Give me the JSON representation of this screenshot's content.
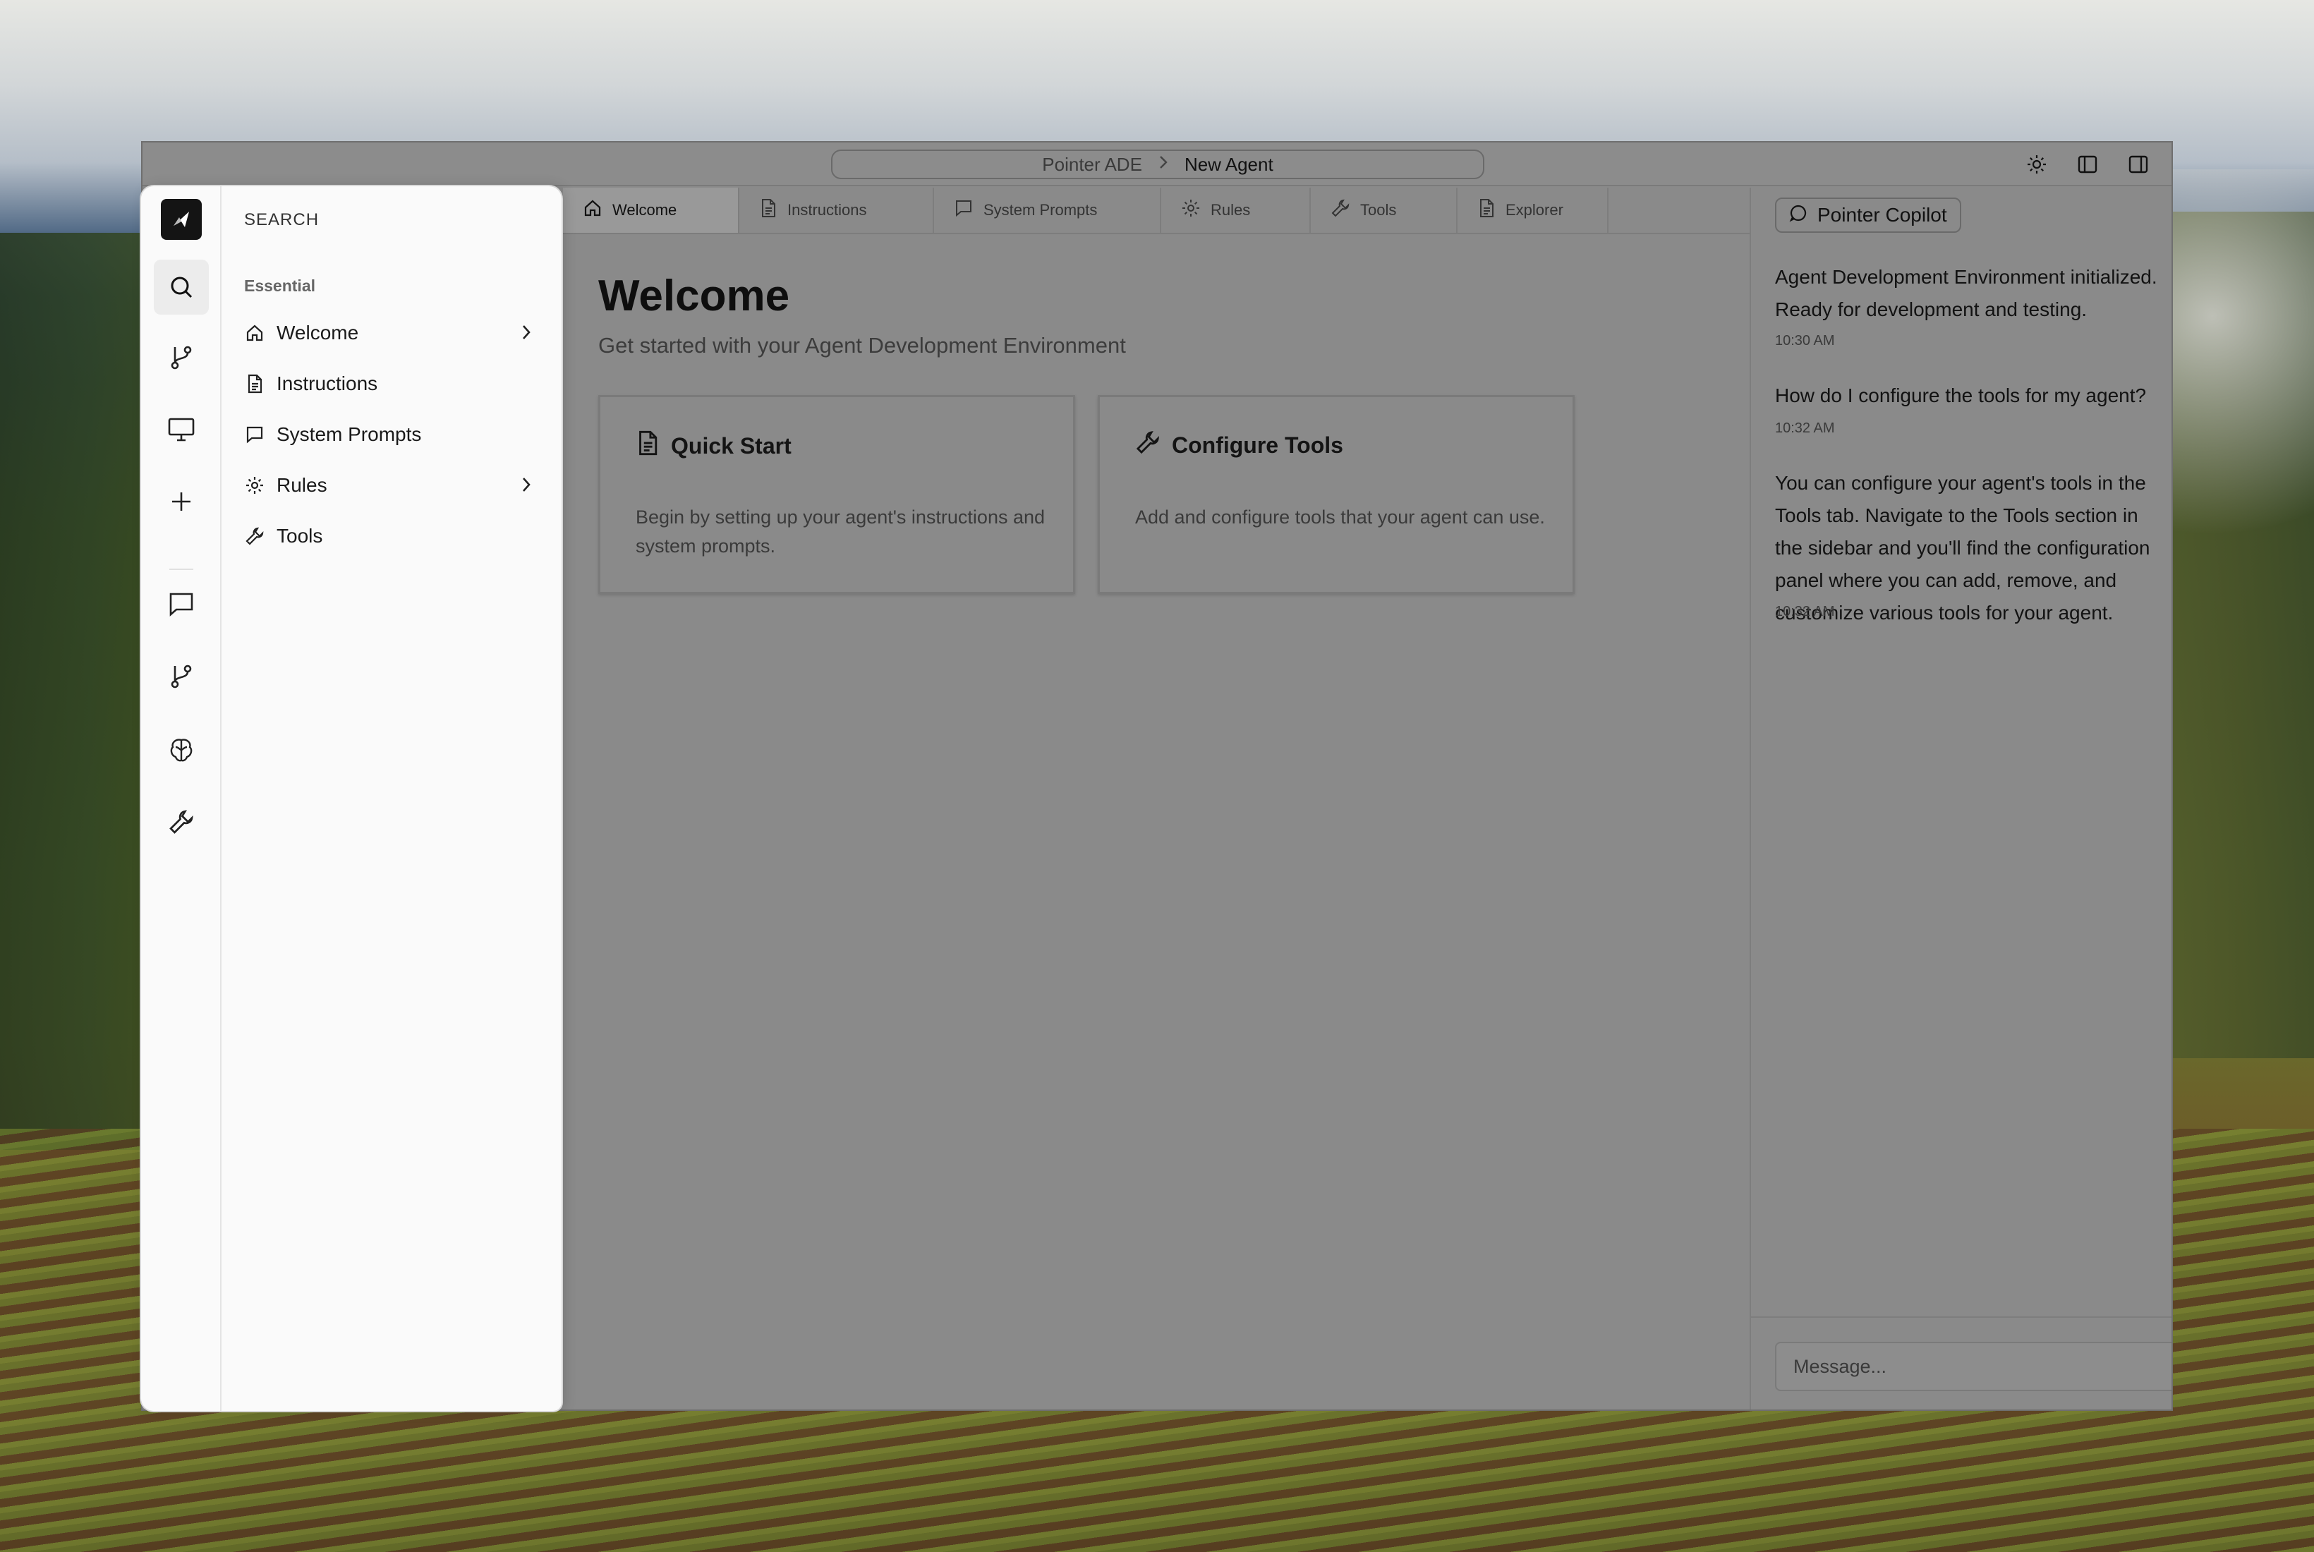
{
  "titlebar": {
    "breadcrumb_root": "Pointer ADE",
    "breadcrumb_current": "New Agent",
    "actions": [
      "sun-icon",
      "sidebar-left-icon",
      "sidebar-right-icon"
    ]
  },
  "sidebar": {
    "rail_icons": [
      "logo-icon",
      "search-icon",
      "git-branch-icon",
      "monitor-icon",
      "plus-icon",
      "message-icon",
      "git-branch-icon",
      "brain-icon",
      "wrench-icon"
    ],
    "search_label": "SEARCH",
    "section_label": "Essential",
    "items": [
      {
        "label": "Welcome",
        "icon": "home-icon",
        "has_children": true
      },
      {
        "label": "Instructions",
        "icon": "document-icon",
        "has_children": false
      },
      {
        "label": "System Prompts",
        "icon": "message-icon",
        "has_children": false
      },
      {
        "label": "Rules",
        "icon": "gear-icon",
        "has_children": true
      },
      {
        "label": "Tools",
        "icon": "wrench-icon",
        "has_children": false
      }
    ]
  },
  "tabs": [
    {
      "label": "Welcome",
      "icon": "home-icon",
      "active": true
    },
    {
      "label": "Instructions",
      "icon": "document-icon",
      "active": false
    },
    {
      "label": "System Prompts",
      "icon": "message-icon",
      "active": false
    },
    {
      "label": "Rules",
      "icon": "gear-icon",
      "active": false
    },
    {
      "label": "Tools",
      "icon": "wrench-icon",
      "active": false
    },
    {
      "label": "Explorer",
      "icon": "document-icon",
      "active": false
    }
  ],
  "main": {
    "title": "Welcome",
    "subtitle": "Get started with your Agent Development Environment",
    "cards": [
      {
        "title": "Quick Start",
        "icon": "document-icon",
        "description": "Begin by setting up your agent's instructions and system prompts."
      },
      {
        "title": "Configure Tools",
        "icon": "wrench-icon",
        "description": "Add and configure tools that your agent can use."
      }
    ]
  },
  "copilot": {
    "title": "Pointer Copilot",
    "messages": [
      {
        "text": "Agent Development Environment initialized. Ready for development and testing.",
        "time": "10:30 AM"
      },
      {
        "text": "How do I configure the tools for my agent?",
        "time": "10:32 AM"
      },
      {
        "text": "You can configure your agent's tools in the Tools tab. Navigate to the Tools section in the sidebar and you'll find the configuration panel where you can add, remove, and customize various tools for your agent.",
        "time": "10:32 AM"
      }
    ],
    "input_placeholder": "Message..."
  }
}
